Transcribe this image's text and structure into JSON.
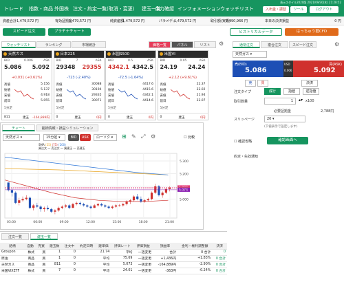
{
  "nav": {
    "items": [
      "トレード",
      "指数・商品",
      "外国株",
      "注文・約定一覧(取消・変更)",
      "建玉一覧",
      "余力確認",
      "インフォメーション",
      "ウォッチリスト"
    ],
    "meta_line1": "表示スタイル2020版",
    "meta_line2": "2021/09/30(木) 21:28:52",
    "deposit_button": "入出金・振替",
    "tools_button": "ツール",
    "logout_button": "ログアウト"
  },
  "account": {
    "items": [
      "資産合計",
      "1,479,572 円",
      "有効証拠金",
      "1,479,572 円",
      "純資産額",
      "1,479,572 円",
      "パラメディ",
      "1,479,572 円",
      "取引額(実績)",
      "7,490,966 円",
      "本日の決済損益",
      "0 円"
    ]
  },
  "actions": {
    "speed_order": "スピード注文",
    "platinum_chart": "プラチナチャート",
    "historical_data": "ヒストリカルデータ",
    "cfd_button": "はっちゅう君CFD"
  },
  "watchlist": {
    "tabs": [
      "ウォッチリスト",
      "ランキング",
      "市場統計"
    ],
    "view_tabs": [
      "価格一覧",
      "パネル",
      "リスト"
    ],
    "cards": [
      {
        "name": "天然ガス",
        "bid_label": "BID",
        "spread": "0.006",
        "ask_label": "ASK",
        "bid": "5.086",
        "ask": "5.092",
        "change": "+0.031 (+0.61%)",
        "change_color": "#d0312d",
        "bid_color": "#222",
        "ask_color": "#222",
        "stats": [
          [
            "高値",
            "5.156"
          ],
          [
            "始値",
            "5.137"
          ],
          [
            "安値",
            "4.918"
          ],
          [
            "前日",
            "5.055"
          ]
        ],
        "foot_left": "811",
        "foot_mid": "建玉",
        "foot_right": "-164,889円",
        "tf": "5分足"
      },
      {
        "name": "日本225",
        "bid_label": "BID",
        "spread": "7",
        "ask_label": "ASK",
        "bid": "29348",
        "ask": "29355",
        "change": "-723 (-2.40%)",
        "change_color": "#1d4fb5",
        "bid_color": "#222",
        "ask_color": "#d0312d",
        "stats": [
          [
            "高値",
            "30088"
          ],
          [
            "始値",
            "30194"
          ],
          [
            "安値",
            "29335"
          ],
          [
            "前日",
            "30071"
          ]
        ],
        "foot_left": "0",
        "foot_mid": "建玉",
        "foot_right": "0円",
        "tf": "5分足"
      },
      {
        "name": "米国S500",
        "bid_label": "BID",
        "spread": "0.5",
        "ask_label": "ASK",
        "bid": "4342.1",
        "ask": "4342.5",
        "change": "-72.5 (-1.64%)",
        "change_color": "#1d4fb5",
        "bid_color": "#d0312d",
        "ask_color": "#222",
        "stats": [
          [
            "高値",
            "4417.6"
          ],
          [
            "始値",
            "4415.6"
          ],
          [
            "安値",
            "4342.1"
          ],
          [
            "前日",
            "4414.6"
          ]
        ],
        "foot_left": "0",
        "foot_mid": "建玉",
        "foot_right": "0円",
        "tf": "5分足"
      },
      {
        "name": "米国VI",
        "bid_label": "BID",
        "spread": "0.05",
        "ask_label": "ASK",
        "bid": "24.19",
        "ask": "24.24",
        "change": "+2.12 (+9.61%)",
        "change_color": "#d0312d",
        "bid_color": "#222",
        "ask_color": "#222",
        "stats": [
          [
            "高値",
            "22.37"
          ],
          [
            "始値",
            "22.02"
          ],
          [
            "安値",
            "21.94"
          ],
          [
            "前日",
            "22.07"
          ]
        ],
        "foot_left": "0",
        "foot_mid": "建玉",
        "foot_right": "0円",
        "tf": "5分足"
      }
    ]
  },
  "chart": {
    "tabs": [
      "チャート",
      "銘柄情報・損益シミュレーション"
    ],
    "symbol": "天然ガス",
    "timeframe": "15分足",
    "bid_tab": "BID",
    "ask_tab": "ASK",
    "candle_label": "ローソク",
    "compare": "比較",
    "legend": [
      "SMA",
      "(25)",
      "(75)",
      "(200)"
    ],
    "indicators": [
      "買注文",
      "売注文",
      "買建玉",
      "売建玉"
    ],
    "price_badges": [
      "5.092",
      "5.080",
      "5.073"
    ],
    "badge_colors": [
      "#e63c78",
      "#d04a70",
      "#8a1fb0"
    ]
  },
  "chart_data": {
    "type": "candlestick",
    "x_ticks": [
      "03:00",
      "06:00",
      "09:00",
      "12:00",
      "15:00",
      "18:00",
      "21:00"
    ],
    "y_ticks": [
      "5.300",
      "5.200",
      "5.100",
      "5.000"
    ],
    "ylim": [
      4.85,
      5.36
    ],
    "candles": [
      [
        5.13,
        5.13,
        5.06,
        5.07
      ],
      [
        5.07,
        5.09,
        5.02,
        5.05
      ],
      [
        5.05,
        5.06,
        4.96,
        4.97
      ],
      [
        4.97,
        5.01,
        4.95,
        4.99
      ],
      [
        4.99,
        5.02,
        4.98,
        5.0
      ],
      [
        5.0,
        5.03,
        4.99,
        5.01
      ],
      [
        5.01,
        5.02,
        4.92,
        4.93
      ],
      [
        4.93,
        4.96,
        4.91,
        4.95
      ],
      [
        4.95,
        4.97,
        4.93,
        4.94
      ],
      [
        4.94,
        4.95,
        4.9,
        4.92
      ],
      [
        4.92,
        4.94,
        4.9,
        4.93
      ],
      [
        4.93,
        4.95,
        4.91,
        4.92
      ],
      [
        4.92,
        4.93,
        4.89,
        4.9
      ],
      [
        4.9,
        4.92,
        4.88,
        4.91
      ],
      [
        4.91,
        4.94,
        4.9,
        4.93
      ],
      [
        4.93,
        4.95,
        4.92,
        4.94
      ],
      [
        4.94,
        4.96,
        4.93,
        4.95
      ],
      [
        4.95,
        4.96,
        4.92,
        4.93
      ],
      [
        4.93,
        4.97,
        4.93,
        4.96
      ],
      [
        4.96,
        4.98,
        4.95,
        4.97
      ],
      [
        4.97,
        4.98,
        4.95,
        4.96
      ],
      [
        4.96,
        4.97,
        4.94,
        4.95
      ],
      [
        4.95,
        4.96,
        4.93,
        4.94
      ],
      [
        4.94,
        4.95,
        4.92,
        4.93
      ],
      [
        4.93,
        4.96,
        4.93,
        4.95
      ],
      [
        4.95,
        4.97,
        4.94,
        4.96
      ],
      [
        4.96,
        4.97,
        4.94,
        4.95
      ],
      [
        4.95,
        4.96,
        4.93,
        4.94
      ],
      [
        4.94,
        4.95,
        4.92,
        4.93
      ],
      [
        4.93,
        4.95,
        4.92,
        4.94
      ],
      [
        4.94,
        4.96,
        4.93,
        4.95
      ],
      [
        4.95,
        4.96,
        4.94,
        4.95
      ],
      [
        4.95,
        4.97,
        4.94,
        4.96
      ],
      [
        4.96,
        4.99,
        4.95,
        4.98
      ],
      [
        4.98,
        5.0,
        4.96,
        4.99
      ],
      [
        4.99,
        5.03,
        4.98,
        5.02
      ],
      [
        5.02,
        5.04,
        4.99,
        5.0
      ],
      [
        5.0,
        5.02,
        4.97,
        4.98
      ],
      [
        4.98,
        5.0,
        4.97,
        4.99
      ],
      [
        4.99,
        5.01,
        4.98,
        5.0
      ],
      [
        5.0,
        5.06,
        4.99,
        5.05
      ],
      [
        5.05,
        5.12,
        5.04,
        5.1
      ],
      [
        5.1,
        5.11,
        5.02,
        5.03
      ],
      [
        5.03,
        5.06,
        5.01,
        5.05
      ],
      [
        5.05,
        5.09,
        5.04,
        5.08
      ],
      [
        5.08,
        5.1,
        5.06,
        5.09
      ]
    ],
    "sma": [
      {
        "values": [
          5.24,
          5.23,
          5.21,
          5.19
        ],
        "color": "#e8a31c"
      },
      {
        "values": [
          5.15,
          5.1,
          5.05,
          5.01,
          4.99,
          4.98,
          4.98,
          4.99
        ],
        "color": "#d0312d"
      },
      {
        "values": [
          5.33,
          5.3,
          5.27,
          5.24,
          5.21,
          5.19
        ],
        "color": "#2f77d8"
      }
    ]
  },
  "order_panel": {
    "tabs": [
      "通常注文",
      "複合注文",
      "スピード注文"
    ],
    "symbol": "天然ガス",
    "bid_label": "売(BID)",
    "ask_label": "買(ASK)",
    "bid": "5.086",
    "ask": "5.092",
    "currency": "USD",
    "spread": "0.006",
    "side_sell": "売",
    "side_buy": "買",
    "settle": "決済",
    "type_label": "注文タイプ",
    "types": [
      "成行",
      "指値",
      "逆指値"
    ],
    "qty_label": "取引数量",
    "qty": "1",
    "unit": "x100",
    "margin_label": "必要証拠金",
    "margin": "2,788円",
    "slip_label": "スリッページ",
    "slip": "20",
    "slip_note": "(下値表示で設定します)",
    "confirm_label": "確認省略",
    "confirm_button": "確認画面へ",
    "notice_label": "約定・失効通知"
  },
  "positions": {
    "tabs": [
      "注文一覧",
      "建玉一覧"
    ],
    "headers": [
      "銘柄",
      "自動",
      "売買",
      "建玉数",
      "注文中",
      "約定日時",
      "建単価",
      "評価レート",
      "評価損益",
      "損益率",
      "金利・権利調整額",
      "決済"
    ],
    "rows": [
      [
        "Groupon",
        "株式",
        "買",
        "1",
        "0",
        "",
        "21.74",
        "平均",
        "一括変更",
        "合計",
        "0 合計",
        "0",
        "—",
        "決済"
      ],
      [
        "原油",
        "商品",
        "買",
        "1",
        "0",
        "",
        "平均",
        "75.69",
        "一括変更",
        "+1,436円",
        "+1.83%",
        "0 合計",
        "—",
        "決済"
      ],
      [
        "天然ガス",
        "商品",
        "買",
        "811",
        "0",
        "",
        "平均",
        "5.073",
        "一括変更",
        "-164,889円",
        "-2.90%",
        "0 合計",
        "—",
        "決済"
      ],
      [
        "米国VIXETF",
        "株式",
        "買",
        "7",
        "0",
        "",
        "平均",
        "24.01",
        "一括変更",
        "-363円",
        "-0.24%",
        "0 合計",
        "—",
        "決済"
      ]
    ]
  }
}
